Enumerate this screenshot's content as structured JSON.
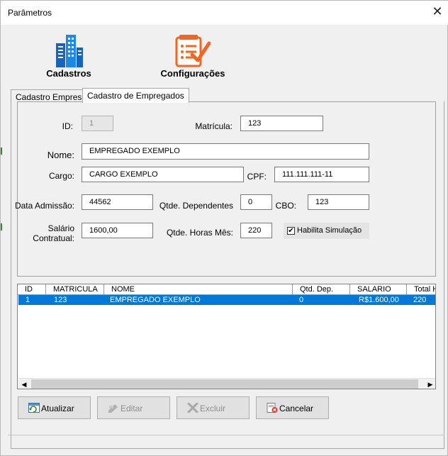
{
  "window": {
    "title": "Parâmetros",
    "close_glyph": "✕"
  },
  "toolbar": {
    "cadastros": {
      "label": "Cadastros",
      "icon": "buildings-icon",
      "color": "#1565c0"
    },
    "configuracoes": {
      "label": "Configurações",
      "icon": "document-checkmark-icon",
      "color": "#f26522"
    }
  },
  "tabs": [
    {
      "label": "Cadastro Empresa",
      "active": false
    },
    {
      "label": "Cadastro de Empregados",
      "active": true
    }
  ],
  "form": {
    "id": {
      "label": "ID:",
      "value": "1"
    },
    "matricula": {
      "label": "Matrícula:",
      "value": "123"
    },
    "nome": {
      "label": "Nome:",
      "value": "EMPREGADO EXEMPLO"
    },
    "cargo": {
      "label": "Cargo:",
      "value": "CARGO EXEMPLO"
    },
    "cpf": {
      "label": "CPF:",
      "value": "111.111.111-11"
    },
    "data_admissao": {
      "label": "Data Admissão:",
      "value": "44562"
    },
    "qtde_dependentes": {
      "label": "Qtde. Dependentes",
      "value": "0"
    },
    "cbo": {
      "label": "CBO:",
      "value": "123"
    },
    "salario": {
      "label_line1": "Salário",
      "label_line2": "Contratual:",
      "value": "1600,00"
    },
    "horas_mes": {
      "label": "Qtde. Horas Mês:",
      "value": "220"
    },
    "habilita_simulacao": {
      "label": "Habilita Simulação",
      "checked": true,
      "mark": "✔"
    }
  },
  "grid": {
    "columns": [
      "ID",
      "MATRICULA",
      "NOME",
      "Qtd. Dep.",
      "SALARIO",
      "Total H"
    ],
    "rows": [
      [
        "1",
        "123",
        "EMPREGADO EXEMPLO",
        "0",
        "R$1.600,00",
        "220"
      ]
    ],
    "selected_color": "#0078d7",
    "scroll_left": "◀",
    "scroll_right": "▶"
  },
  "buttons": {
    "atualizar": {
      "label": "Atualizar",
      "enabled": true
    },
    "editar": {
      "label": "Editar",
      "enabled": false
    },
    "excluir": {
      "label": "Excluir",
      "enabled": false
    },
    "cancelar": {
      "label": "Cancelar",
      "enabled": true
    }
  }
}
